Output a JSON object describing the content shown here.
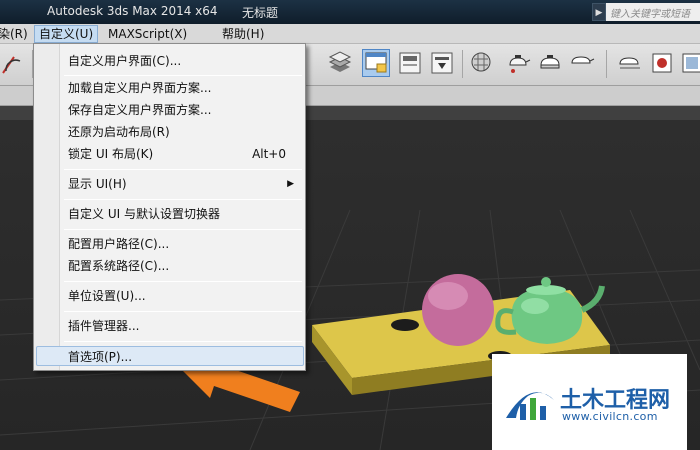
{
  "title_bar": {
    "app_title": "Autodesk 3ds Max  2014 x64",
    "document_title": "无标题",
    "search_placeholder": "键入关键字或短语"
  },
  "menu_bar": {
    "items": [
      {
        "label": "染(R)"
      },
      {
        "label": "自定义(U)"
      },
      {
        "label": "MAXScript(X)"
      },
      {
        "label": "帮助(H)"
      }
    ]
  },
  "customize_menu": {
    "items": [
      {
        "label": "自定义用户界面(C)..."
      },
      {
        "label": "加载自定义用户界面方案..."
      },
      {
        "label": "保存自定义用户界面方案..."
      },
      {
        "label": "还原为启动布局(R)"
      },
      {
        "label": "锁定 UI 布局(K)",
        "shortcut": "Alt+0"
      },
      {
        "label": "显示 UI(H)",
        "submenu_arrow": "▶"
      },
      {
        "label": "自定义 UI 与默认设置切换器"
      },
      {
        "label": "配置用户路径(C)..."
      },
      {
        "label": "配置系统路径(C)..."
      },
      {
        "label": "单位设置(U)..."
      },
      {
        "label": "插件管理器..."
      },
      {
        "label": "首选项(P)...",
        "highlighted": true
      }
    ]
  },
  "watermark": {
    "name": "土木工程网",
    "url": "www.civilcn.com"
  },
  "colors": {
    "title_bar": "#16273a",
    "menu_highlight": "#dde9f6",
    "arrow": "#f07f1e",
    "box": "#c8b440",
    "sphere": "#c46c9c",
    "teapot": "#6ec883",
    "watermark_blue": "#1e5fa8"
  }
}
